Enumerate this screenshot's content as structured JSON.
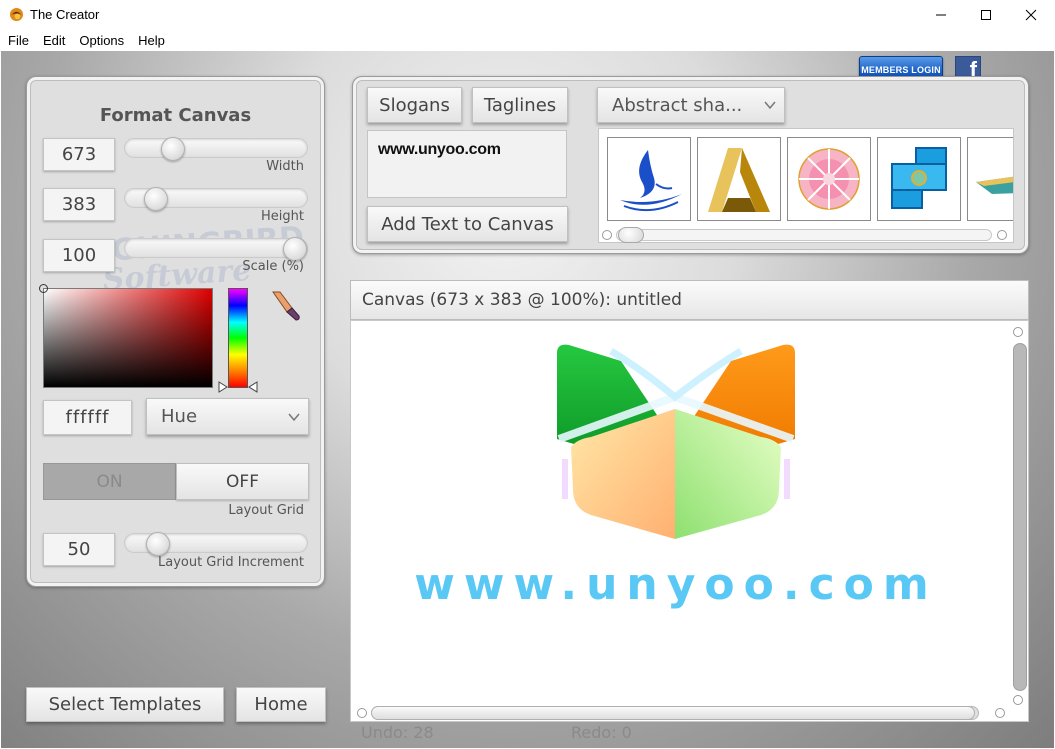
{
  "window": {
    "title": "The Creator"
  },
  "menu": {
    "items": [
      "File",
      "Edit",
      "Options",
      "Help"
    ]
  },
  "header": {
    "members_login": "MEMBERS LOGIN",
    "facebook": "f"
  },
  "format_canvas": {
    "title": "Format Canvas",
    "width": {
      "value": "673",
      "label": "Width",
      "slider_fraction": 0.23
    },
    "height": {
      "value": "383",
      "label": "Height",
      "slider_fraction": 0.12
    },
    "scale": {
      "value": "100",
      "label": "Scale (%)",
      "slider_fraction": 1.0
    },
    "color_hex": "ffffff",
    "color_mode": "Hue",
    "grid_on": "ON",
    "grid_off": "OFF",
    "grid_state": "OFF",
    "grid_label": "Layout Grid",
    "grid_increment": {
      "value": "50",
      "label": "Layout Grid Increment",
      "slider_fraction": 0.13
    },
    "watermark_line1": "LAUGHINGBIRD",
    "watermark_line2": "Software"
  },
  "text_tools": {
    "tabs": [
      "Slogans",
      "Taglines"
    ],
    "text_value": "www.unyoo.com",
    "add_button": "Add Text to Canvas"
  },
  "shapes": {
    "category": "Abstract sha...",
    "items": [
      "blue-swirl-shape-icon",
      "gold-triangle-shape-icon",
      "pink-flower-shape-icon",
      "blue-cross-shape-icon",
      "stripe-shape-icon"
    ]
  },
  "canvas": {
    "title": "Canvas (673 x 383 @ 100%): untitled",
    "logo_text": "www.unyoo.com"
  },
  "bottom": {
    "select_templates": "Select Templates",
    "home": "Home",
    "undo": "Undo: 28",
    "redo": "Redo: 0"
  },
  "colors": {
    "accent_blue": "#1a67c6",
    "logo_text": "#5ac8f5",
    "panel_bg": "#dfdfdf"
  }
}
